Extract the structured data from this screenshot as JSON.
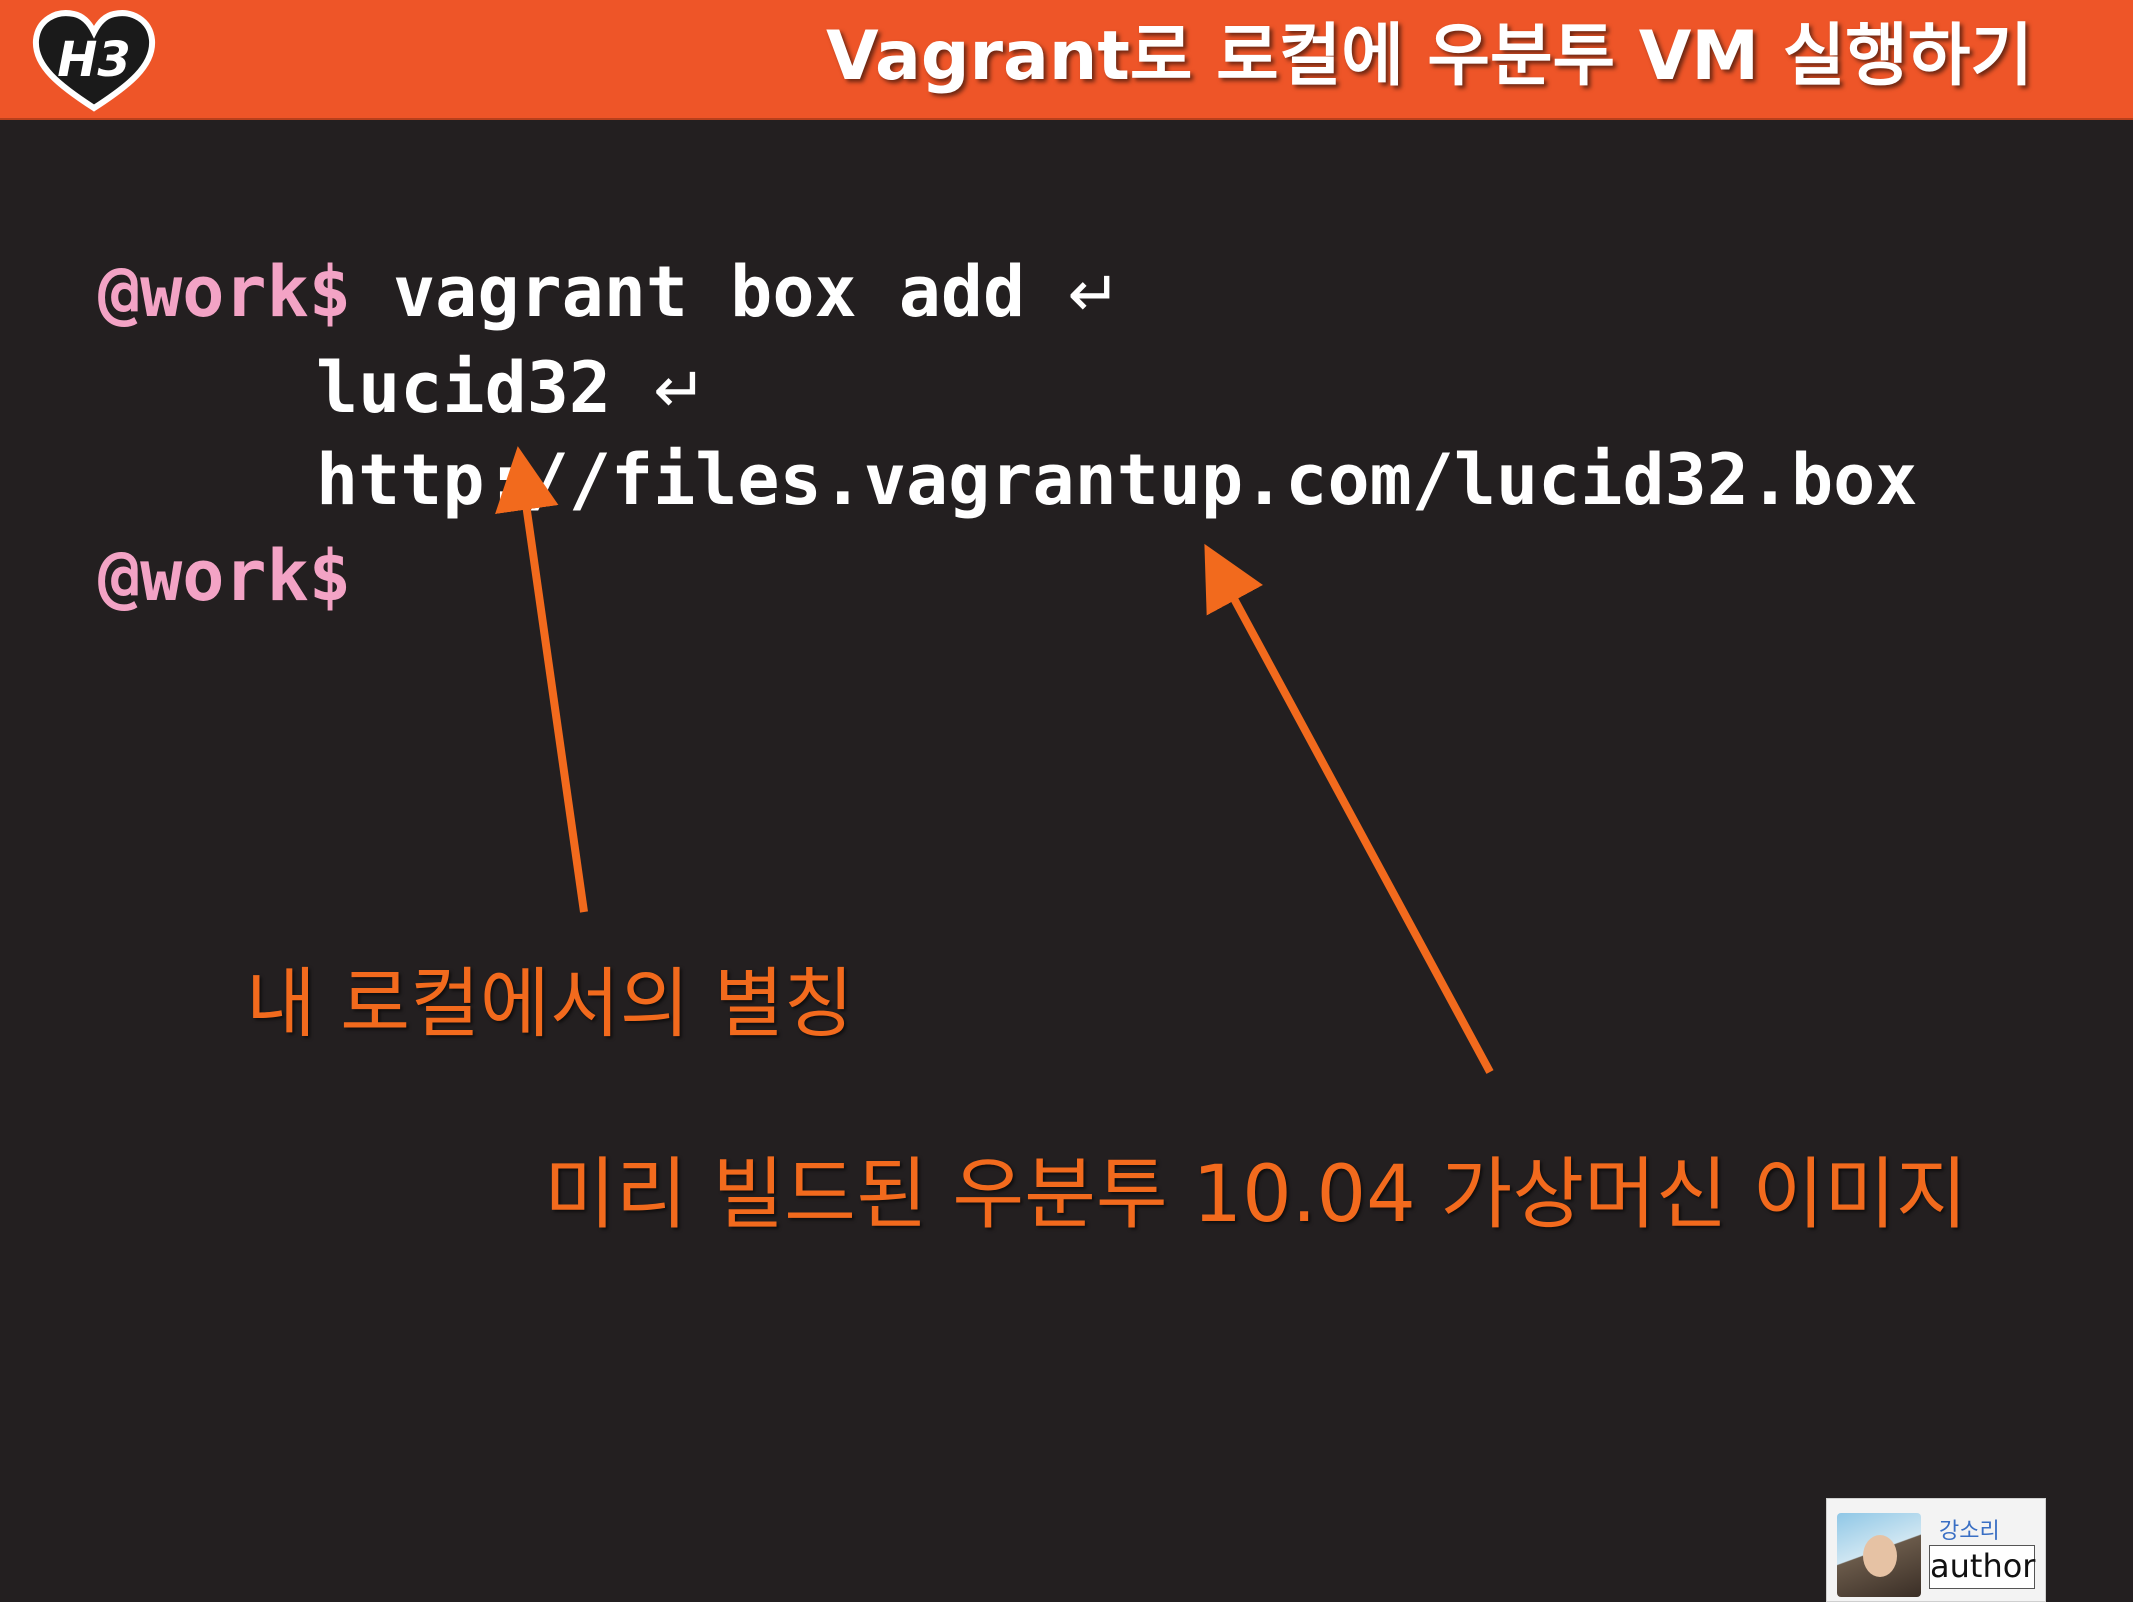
{
  "header": {
    "title": "Vagrant로 로컬에 우분투 VM 실행하기",
    "logo_text": "H3"
  },
  "terminal": {
    "line1": {
      "prompt": "@work$",
      "command": "vagrant box add",
      "enter_glyph": "↵"
    },
    "line2": {
      "text": "lucid32",
      "enter_glyph": "↵"
    },
    "line3": {
      "text": "http://files.vagrantup.com/lucid32.box"
    },
    "line4": {
      "prompt": "@work$"
    }
  },
  "annotations": {
    "alias": "내 로컬에서의 별칭",
    "image": "미리 빌드된 우분투 10.04 가상머신 이미지"
  },
  "author_badge": {
    "name": "강소리",
    "role": "author"
  },
  "colors": {
    "header_bg": "#ee5528",
    "slide_bg": "#231f20",
    "prompt": "#f3a3c5",
    "annotation": "#f26a1d",
    "arrow": "#f26a1d"
  }
}
